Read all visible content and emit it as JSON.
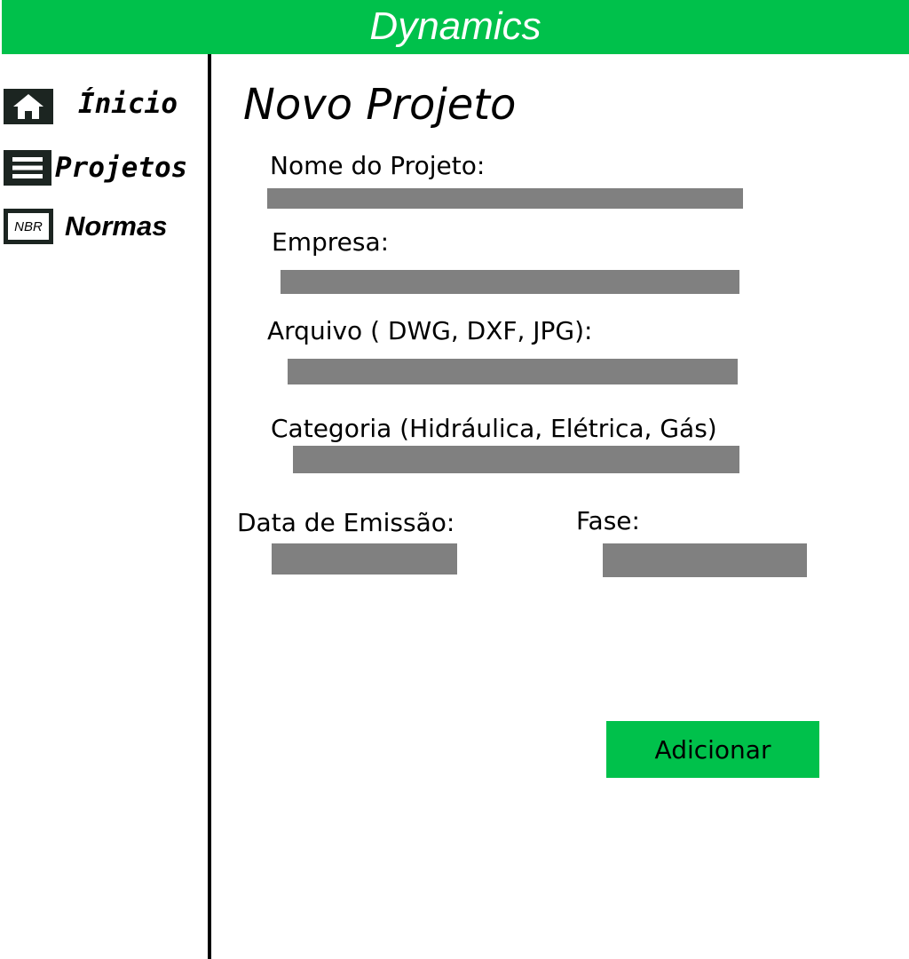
{
  "app": {
    "title": "Dynamics"
  },
  "sidebar": {
    "items": [
      {
        "label": "Ínicio",
        "icon": "home-icon"
      },
      {
        "label": "Projetos",
        "icon": "list-icon"
      },
      {
        "label": "Normas",
        "icon": "nbr-icon",
        "icon_text": "NBR"
      }
    ]
  },
  "main": {
    "title": "Novo Projeto",
    "fields": {
      "nome": {
        "label": "Nome do Projeto:",
        "value": ""
      },
      "empresa": {
        "label": "Empresa:",
        "value": ""
      },
      "arquivo": {
        "label": "Arquivo ( DWG, DXF, JPG):",
        "value": ""
      },
      "categoria": {
        "label": "Categoria (Hidráulica, Elétrica, Gás)",
        "value": ""
      },
      "data_emissao": {
        "label": "Data de Emissão:",
        "value": ""
      },
      "fase": {
        "label": "Fase:",
        "value": ""
      }
    },
    "submit_label": "Adicionar"
  },
  "colors": {
    "accent": "#00c14b",
    "input": "#808080",
    "icon_bg": "#1c2521"
  }
}
